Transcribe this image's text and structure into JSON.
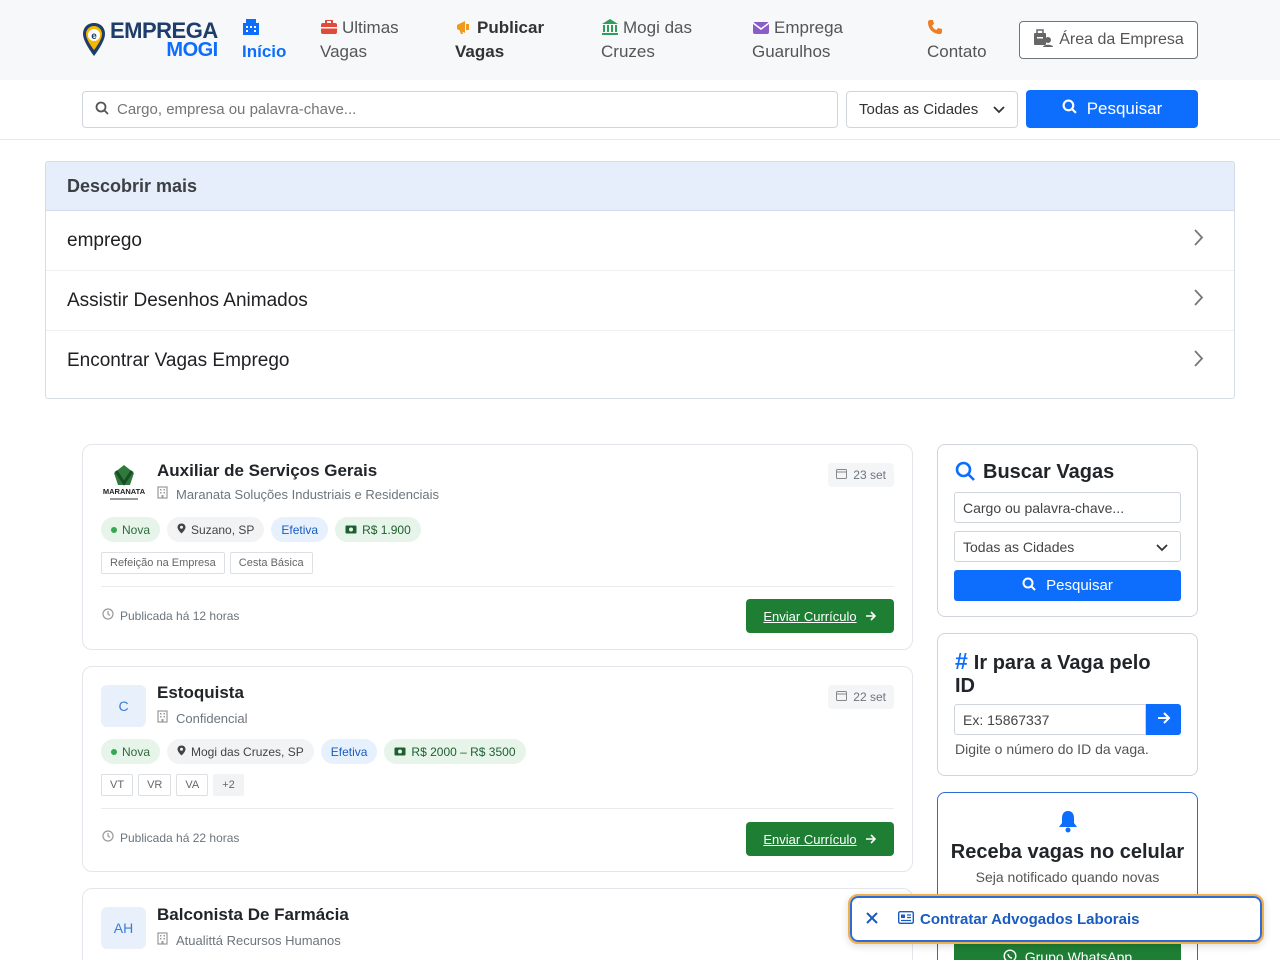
{
  "header": {
    "logo": {
      "line1": "EMPREGA",
      "line2": "MOGI"
    },
    "nav": [
      {
        "icon": "building-icon",
        "line1": "Início",
        "line2": ""
      },
      {
        "icon": "briefcase-icon",
        "line1": "Ultimas",
        "line2": "Vagas"
      },
      {
        "icon": "megaphone-icon",
        "line1": "Publicar",
        "line2": "Vagas"
      },
      {
        "icon": "bank-icon",
        "line1": "Mogi das",
        "line2": "Cruzes"
      },
      {
        "icon": "envelope-icon",
        "line1": "Emprega",
        "line2": "Guarulhos"
      },
      {
        "icon": "phone-icon",
        "line1": "",
        "line2": "Contato"
      }
    ],
    "area_button": "Área da Empresa",
    "colors": {
      "accent": "#0d6efd",
      "apply": "#1e7e34",
      "promo_border": "#f0b04f"
    }
  },
  "search": {
    "placeholder": "Cargo, empresa ou palavra-chave...",
    "city": "Todas as Cidades",
    "button": "Pesquisar"
  },
  "discover": {
    "title": "Descobrir mais",
    "items": [
      {
        "label": "emprego"
      },
      {
        "label": "Assistir Desenhos Animados"
      },
      {
        "label": "Encontrar Vagas Emprego"
      }
    ]
  },
  "jobs": [
    {
      "logo": "",
      "title": "Auxiliar de Serviços Gerais",
      "company": "Maranata Soluções Industriais e Residenciais",
      "date": "23 set",
      "badge_new": "Nova",
      "location": "Suzano, SP",
      "type": "Efetiva",
      "salary": "R$ 1.900",
      "tags": [
        "Refeição na Empresa",
        "Cesta Básica"
      ],
      "posted": "Publicada há 12 horas",
      "apply": "Enviar Currículo"
    },
    {
      "logo": "C",
      "title": "Estoquista",
      "company": "Confidencial",
      "date": "22 set",
      "badge_new": "Nova",
      "location": "Mogi das Cruzes, SP",
      "type": "Efetiva",
      "salary": "R$ 2000 – R$ 3500",
      "tags": [
        "VT",
        "VR",
        "VA",
        "+2"
      ],
      "posted": "Publicada há 22 horas",
      "apply": "Enviar Currículo"
    },
    {
      "logo": "AH",
      "title": "Balconista De Farmácia",
      "company": "Atualittá Recursos Humanos"
    }
  ],
  "sidebar": {
    "search": {
      "title": "Buscar Vagas",
      "placeholder": "Cargo ou palavra-chave...",
      "city": "Todas as Cidades",
      "button": "Pesquisar"
    },
    "by_id": {
      "title_line1": "Ir para a Vaga pelo",
      "title_line2": "ID",
      "placeholder": "Ex: 15867337",
      "help": "Digite o número do ID da vaga."
    },
    "notify": {
      "title": "Receba vagas no celular",
      "text": "Seja notificado quando novas",
      "whatsapp": "Grupo WhatsApp"
    }
  },
  "promo": {
    "label": "Contratar Advogados Laborais"
  }
}
